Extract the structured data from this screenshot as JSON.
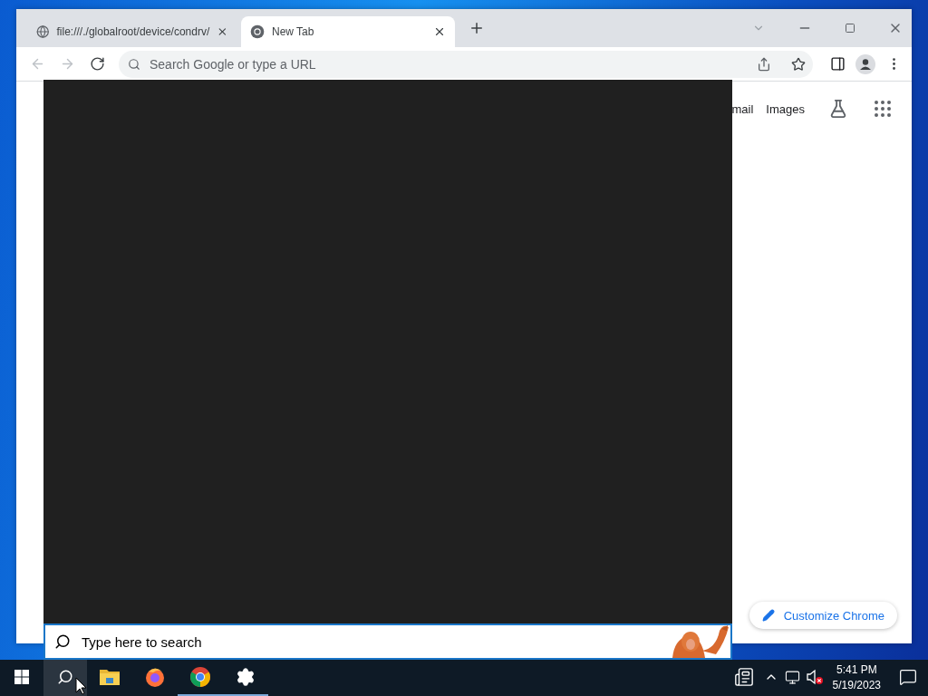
{
  "browser": {
    "tabs": [
      {
        "title": "file:///./globalroot/device/condrv/",
        "kind": "file",
        "selected": false
      },
      {
        "title": "New Tab",
        "kind": "chrome",
        "selected": true
      }
    ],
    "nav_buttons": [
      {
        "kind": "back",
        "disabled": true
      },
      {
        "kind": "forward",
        "disabled": true
      },
      {
        "kind": "reload",
        "disabled": false
      }
    ],
    "omnibox": {
      "placeholder": "Search Google or type a URL"
    },
    "ntp_links": [
      "mail",
      "Images"
    ],
    "customize_button": "Customize Chrome"
  },
  "search_popup": {
    "placeholder": "Type here to search"
  },
  "taskbar": {
    "search_button": {
      "selected": true
    },
    "apps": [
      {
        "kind": "files",
        "running": false
      },
      {
        "kind": "firefox",
        "running": false
      },
      {
        "kind": "chrome",
        "running": true
      },
      {
        "kind": "settings",
        "running": true
      }
    ],
    "volume": {
      "muted": true
    },
    "time": "5:41 PM",
    "date": "5/19/2023"
  }
}
